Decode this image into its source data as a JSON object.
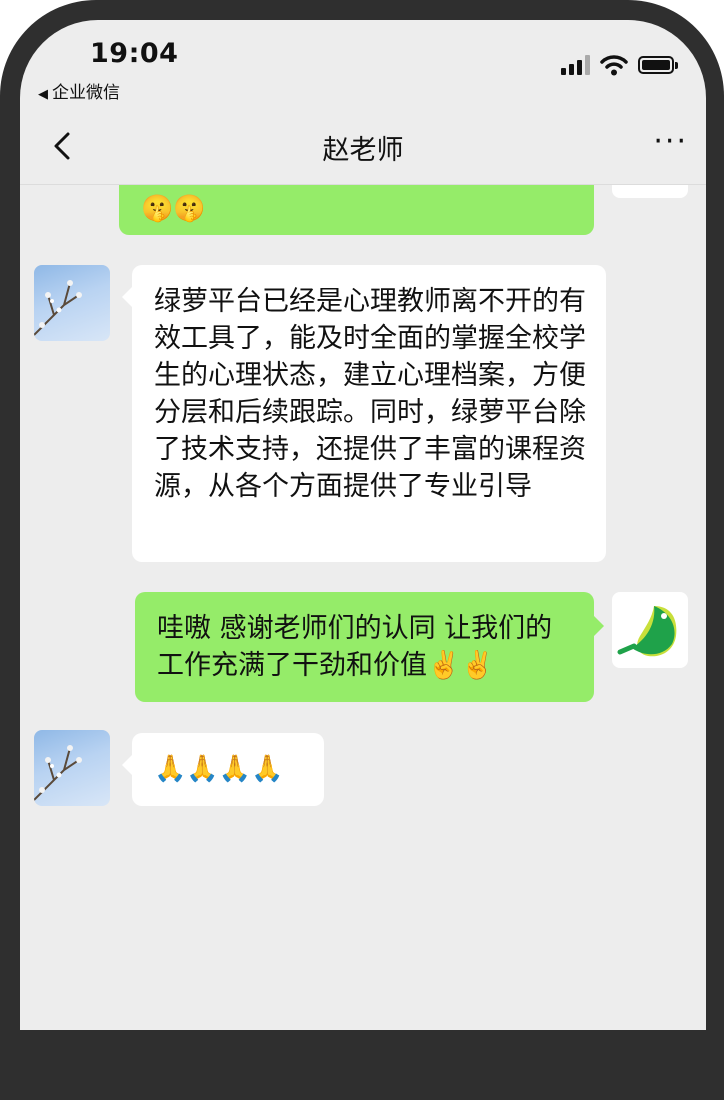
{
  "status_bar": {
    "time": "19:04",
    "back_app": "企业微信"
  },
  "header": {
    "title": "赵老师",
    "more": "···"
  },
  "messages": [
    {
      "sender": "me",
      "text": "🤫🤫"
    },
    {
      "sender": "teacher",
      "text": "绿萝平台已经是心理教师离不开的有效工具了，能及时全面的掌握全校学生的心理状态，建立心理档案，方便分层和后续跟踪。同时，绿萝平台除了技术支持，还提供了丰富的课程资源，从各个方面提供了专业引导"
    },
    {
      "sender": "me",
      "text": "哇嗷 感谢老师们的认同 让我们的工作充满了干劲和价值✌️✌️"
    },
    {
      "sender": "teacher",
      "text": "🙏🙏🙏🙏"
    }
  ],
  "colors": {
    "my_bubble": "#95ec69",
    "their_bubble": "#ffffff",
    "background": "#ededed",
    "frame": "#2f2f2f"
  },
  "icons": {
    "back": "chevron-left-icon",
    "more": "more-dots-icon",
    "signal": "signal-icon",
    "wifi": "wifi-icon",
    "battery": "battery-icon"
  }
}
